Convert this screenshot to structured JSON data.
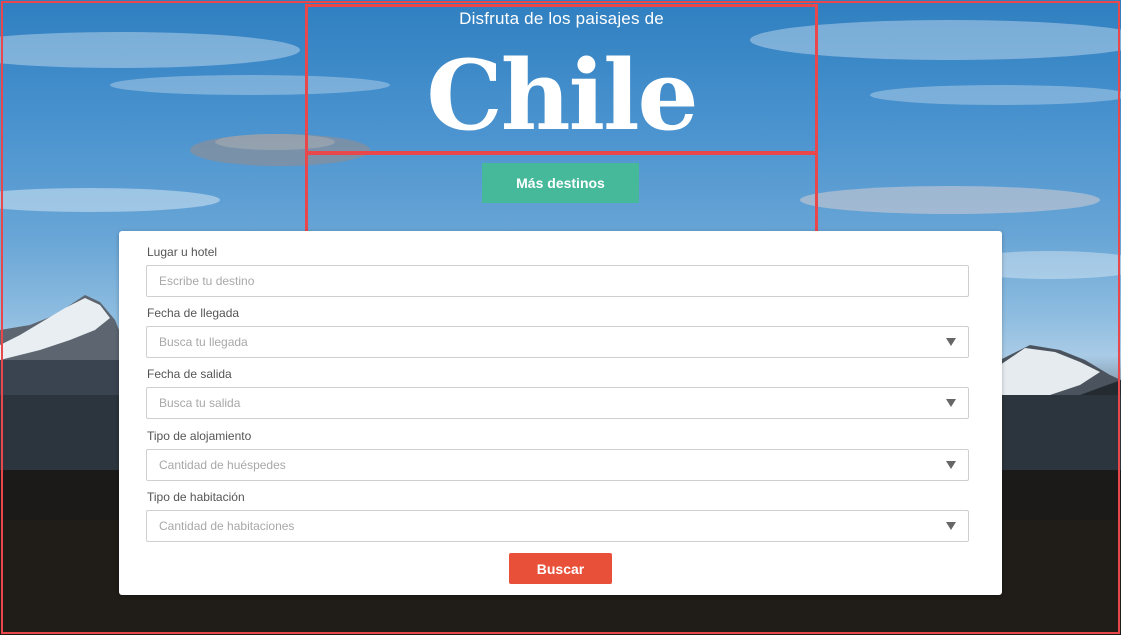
{
  "hero": {
    "subtitle": "Disfruta de los paisajes de",
    "title": "Chile",
    "more_button": "Más destinos"
  },
  "form": {
    "place": {
      "label": "Lugar u hotel",
      "placeholder": "Escribe tu destino"
    },
    "arrival": {
      "label": "Fecha de llegada",
      "placeholder": "Busca tu llegada"
    },
    "departure": {
      "label": "Fecha de salida",
      "placeholder": "Busca tu salida"
    },
    "lodging": {
      "label": "Tipo de alojamiento",
      "placeholder": "Cantidad de huéspedes"
    },
    "room": {
      "label": "Tipo de habitación",
      "placeholder": "Cantidad de habitaciones"
    },
    "search_button": "Buscar"
  },
  "colors": {
    "accent_green": "#45b99a",
    "accent_red": "#e8503a",
    "frame_red": "#e8474c"
  },
  "icons": {
    "select_caret": "caret-down-icon"
  }
}
